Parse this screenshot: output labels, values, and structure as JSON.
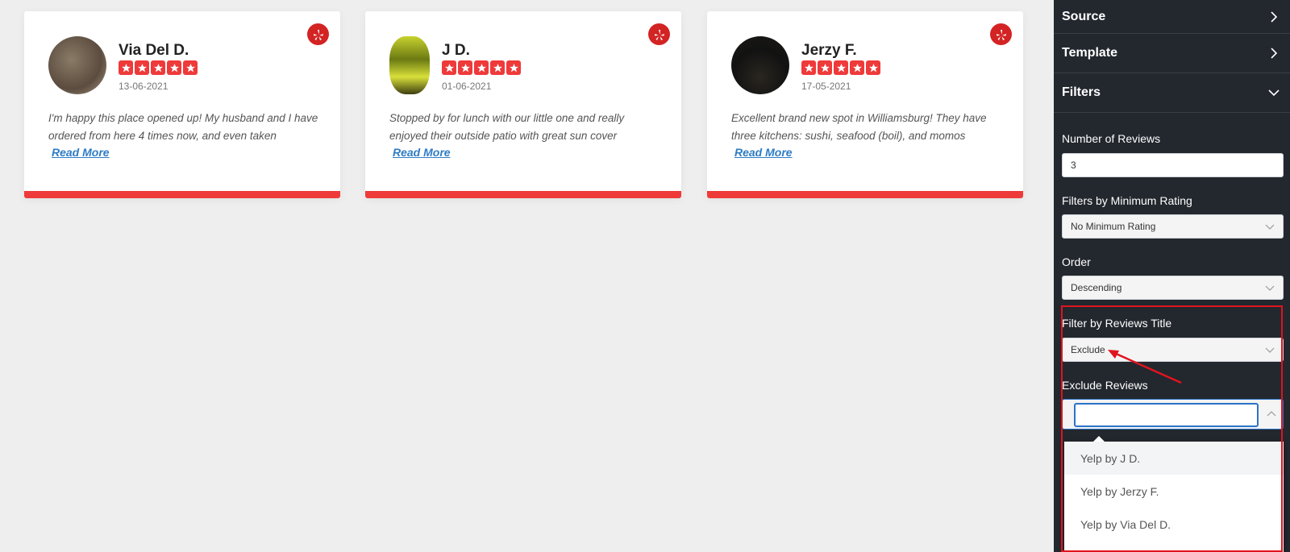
{
  "reviews": [
    {
      "name": "Via Del D.",
      "date": "13-06-2021",
      "rating": 5,
      "text": "I'm happy this place opened up! My husband and I have ordered from here 4 times now, and even taken",
      "read_more": "Read More"
    },
    {
      "name": "J D.",
      "date": "01-06-2021",
      "rating": 5,
      "text": "Stopped by for lunch with our little one and really enjoyed their outside patio with great sun cover",
      "read_more": "Read More"
    },
    {
      "name": "Jerzy F.",
      "date": "17-05-2021",
      "rating": 5,
      "text": "Excellent brand new spot in Williamsburg! They have three kitchens: sushi, seafood (boil), and momos",
      "read_more": "Read More"
    }
  ],
  "panel": {
    "sections": [
      "Source",
      "Template",
      "Filters"
    ],
    "number_of_reviews": {
      "label": "Number of Reviews",
      "value": "3"
    },
    "min_rating": {
      "label": "Filters by Minimum Rating",
      "value": "No Minimum Rating"
    },
    "order": {
      "label": "Order",
      "value": "Descending"
    },
    "title_filter": {
      "label": "Filter by Reviews Title",
      "value": "Exclude"
    },
    "exclude_reviews": {
      "label": "Exclude Reviews",
      "value": ""
    },
    "dropdown_options": [
      "Yelp by J D.",
      "Yelp by Jerzy F.",
      "Yelp by Via Del D."
    ]
  },
  "colors": {
    "accent_red": "#ef3a3a",
    "yelp_red": "#d32323",
    "panel_bg": "#23272e",
    "link_blue": "#2e7cc4"
  },
  "icons": {
    "source_badge": "yelp-icon",
    "rating": "star-icon"
  }
}
